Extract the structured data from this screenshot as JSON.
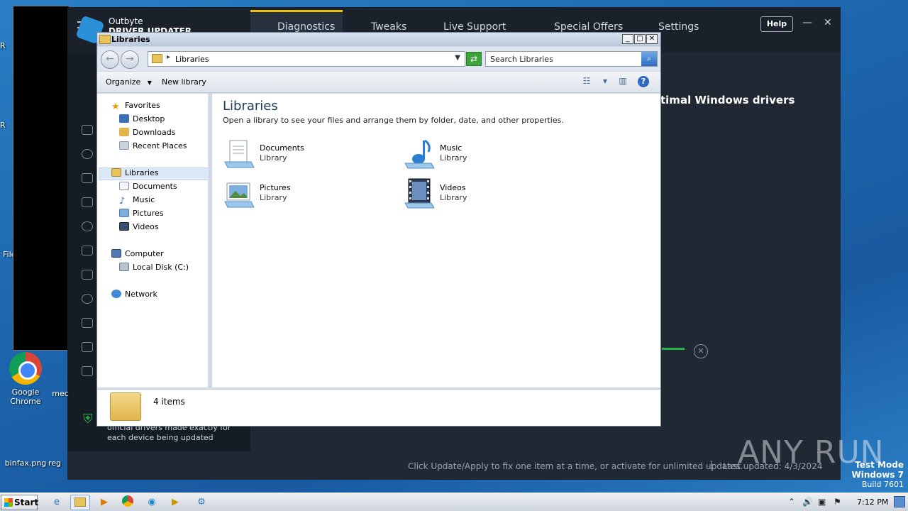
{
  "desktop": {
    "icons": [
      {
        "label": "Google Chrome"
      },
      {
        "label": "binfax.png"
      },
      {
        "label": "reg"
      },
      {
        "label": "mec"
      }
    ],
    "edge_fragments": [
      "R",
      "R",
      "File"
    ]
  },
  "outbyte": {
    "brand_top": "Outbyte",
    "brand_bottom": "DRIVER UPDATER",
    "tabs": [
      "Diagnostics",
      "Tweaks",
      "Live Support",
      "Special Offers",
      "Settings"
    ],
    "help_label": "Help",
    "heading": "timal Windows drivers",
    "tagline": "official drivers made exactly for each device being updated",
    "footer_text": "Click Update/Apply to fix one item at a time, or activate for unlimited updates.",
    "footer_sep": "|",
    "last_updated": "Last updated: 4/3/2024",
    "accent_color": "#26b24a"
  },
  "explorer": {
    "title": "Libraries",
    "address": "Libraries",
    "search_placeholder": "Search Libraries",
    "toolbar": {
      "organize": "Organize",
      "new_library": "New library"
    },
    "nav": {
      "favorites": "Favorites",
      "desktop": "Desktop",
      "downloads": "Downloads",
      "recent_places": "Recent Places",
      "libraries": "Libraries",
      "documents": "Documents",
      "music": "Music",
      "pictures": "Pictures",
      "videos": "Videos",
      "computer": "Computer",
      "local_disk": "Local Disk (C:)",
      "network": "Network"
    },
    "content": {
      "heading": "Libraries",
      "description": "Open a library to see your files and arrange them by folder, date, and other properties.",
      "items": [
        {
          "name": "Documents",
          "type": "Library",
          "icon": "documents-library-icon"
        },
        {
          "name": "Music",
          "type": "Library",
          "icon": "music-library-icon"
        },
        {
          "name": "Pictures",
          "type": "Library",
          "icon": "pictures-library-icon"
        },
        {
          "name": "Videos",
          "type": "Library",
          "icon": "videos-library-icon"
        }
      ]
    },
    "status": "4 items"
  },
  "watermark": "ANY RUN",
  "test_mode": {
    "line1": "Test Mode",
    "line2": "Windows 7",
    "line3": "Build 7601"
  },
  "taskbar": {
    "start_label": "Start",
    "clock": "7:12 PM"
  }
}
